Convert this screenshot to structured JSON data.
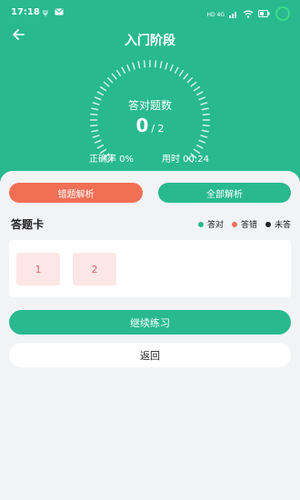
{
  "status_bar": {
    "time": "17:18",
    "usb_icon": "ψ",
    "network": "HD 4G"
  },
  "header": {
    "title": "入门阶段"
  },
  "dial": {
    "label": "答对题数",
    "correct": "0",
    "total": "/ 2"
  },
  "stats": {
    "accuracy": "正确率 0%",
    "time_used": "用时 00:24"
  },
  "actions": {
    "wrong_analysis": "错题解析",
    "all_analysis": "全部解析"
  },
  "answer_card": {
    "title": "答题卡",
    "legend": [
      {
        "label": "答对",
        "color": "#28b98f"
      },
      {
        "label": "答错",
        "color": "#f06f55"
      },
      {
        "label": "未答",
        "color": "#222222"
      }
    ],
    "questions": [
      "1",
      "2"
    ]
  },
  "bottom": {
    "continue": "继续练习",
    "return": "返回"
  },
  "colors": {
    "primary": "#28b98f",
    "wrong": "#f06f55",
    "wrong_bg": "#fde6e6"
  }
}
